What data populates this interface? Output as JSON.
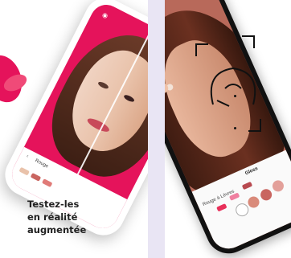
{
  "headline": {
    "line1": "Testez-les",
    "line2": "en réalité",
    "line3": "augmentée"
  },
  "left_phone": {
    "category_label": "Rouge"
  },
  "right_phone": {
    "category_label": "Rouge à Lèvres",
    "active_tab": "Gloss"
  },
  "colors": {
    "background": "#e9e5f4",
    "brand_pink": "#e5135b",
    "lipstick": "#e8305a"
  },
  "swatches_right": [
    "#d98a7a",
    "#c96560",
    "#e3a09a",
    "#e07b78"
  ]
}
